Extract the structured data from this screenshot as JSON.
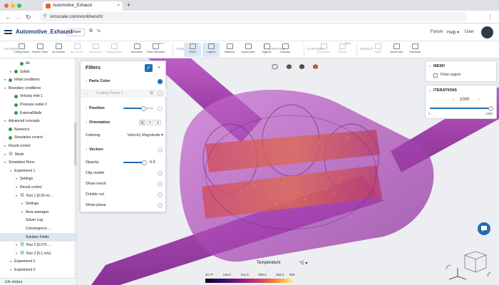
{
  "browser": {
    "tab_title": "Automotive_Exhaust",
    "tab_close": "×",
    "new_tab": "+",
    "url": "simscale.com/workbench/",
    "back": "←",
    "forward": "→",
    "reload": "↻",
    "menu": "⋮"
  },
  "header": {
    "project": "Automotive_Exhaust",
    "share": "Share",
    "links": [
      "Forum",
      "Help ▾",
      "User"
    ],
    "avatar_initial": ""
  },
  "toolbar": {
    "groups": [
      "FILTERS",
      "VIEW",
      "COMPARE",
      "CAPTURE",
      "RESULT"
    ],
    "tools": [
      {
        "label": "Cutting Plane",
        "dim": false,
        "active": false
      },
      {
        "label": "Particle Trace",
        "dim": false,
        "active": false
      },
      {
        "label": "Iso Surface",
        "dim": false,
        "active": false
      },
      {
        "label": "Iso Volume",
        "dim": true,
        "active": false
      },
      {
        "label": "Streamlines",
        "dim": true,
        "active": false
      },
      {
        "label": "Displacement",
        "dim": true,
        "active": false
      },
      {
        "label": "Animation",
        "dim": false,
        "active": false
      },
      {
        "label": "Field Calculator",
        "dim": false,
        "active": false,
        "beta": "BETA"
      },
      {
        "label": "Filters",
        "dim": false,
        "active": true
      },
      {
        "label": "Legend",
        "dim": false,
        "active": true
      },
      {
        "label": "Statistics",
        "dim": false,
        "active": false
      },
      {
        "label": "Import point",
        "dim": false,
        "active": false
      },
      {
        "label": "Regions",
        "dim": false,
        "active": false
      },
      {
        "label": "Compare",
        "dim": false,
        "active": false
      },
      {
        "label": "Screenshot",
        "dim": true,
        "active": false
      },
      {
        "label": "Record",
        "dim": true,
        "active": false,
        "beta": "BETA"
      },
      {
        "label": "Reset",
        "dim": true,
        "active": false
      },
      {
        "label": "Import view",
        "dim": false,
        "active": false
      },
      {
        "label": "Download",
        "dim": false,
        "active": false
      }
    ]
  },
  "tree": {
    "items": [
      {
        "label": "Air",
        "indent": 3,
        "arrow": false,
        "status": "ok"
      },
      {
        "label": "Solids",
        "indent": 2,
        "arrow": true,
        "status": "ok"
      },
      {
        "label": "Initial conditions",
        "indent": 1,
        "arrow": true,
        "status": "ok"
      },
      {
        "label": "Boundary conditions",
        "indent": 1,
        "arrow": true,
        "status": "none"
      },
      {
        "label": "Velocity inlet 1",
        "indent": 2,
        "arrow": false,
        "status": "ok"
      },
      {
        "label": "Pressure outlet 2",
        "indent": 2,
        "arrow": false,
        "status": "ok"
      },
      {
        "label": "ExternalWalls",
        "indent": 2,
        "arrow": false,
        "status": "ok"
      },
      {
        "label": "Advanced concepts",
        "indent": 1,
        "arrow": true,
        "status": "none"
      },
      {
        "label": "Numerics",
        "indent": 1,
        "arrow": false,
        "status": "ok"
      },
      {
        "label": "Simulation control",
        "indent": 1,
        "arrow": false,
        "status": "ok"
      },
      {
        "label": "Result control",
        "indent": 1,
        "arrow": true,
        "status": "none"
      },
      {
        "label": "Mesh",
        "indent": 1,
        "arrow": true,
        "status": "gear"
      },
      {
        "label": "Simulation Runs",
        "indent": 1,
        "arrow": true,
        "status": "none"
      },
      {
        "label": "Experiment 1",
        "indent": 2,
        "arrow": true,
        "status": "none"
      },
      {
        "label": "Settings",
        "indent": 3,
        "arrow": true,
        "status": "none"
      },
      {
        "label": "Result control",
        "indent": 3,
        "arrow": true,
        "status": "none"
      },
      {
        "label": "Run 1 [0.05 m/...",
        "indent": 3,
        "arrow": true,
        "status": "gear"
      },
      {
        "label": "Settings",
        "indent": 4,
        "arrow": true,
        "status": "none"
      },
      {
        "label": "Area averages",
        "indent": 4,
        "arrow": true,
        "status": "none"
      },
      {
        "label": "Solver Log",
        "indent": 4,
        "arrow": false,
        "status": "none"
      },
      {
        "label": "Convergence ...",
        "indent": 4,
        "arrow": false,
        "status": "none"
      },
      {
        "label": "Solution Fields",
        "indent": 4,
        "arrow": false,
        "status": "none",
        "selected": true
      },
      {
        "label": "Run 2 [0.075 ...",
        "indent": 3,
        "arrow": true,
        "status": "gear"
      },
      {
        "label": "Run 3 [0.1 m/s]",
        "indent": 3,
        "arrow": true,
        "status": "gear"
      },
      {
        "label": "Experiment 2",
        "indent": 2,
        "arrow": true,
        "status": "none"
      },
      {
        "label": "Experiment 3",
        "indent": 2,
        "arrow": true,
        "status": "none"
      }
    ],
    "job_status": "Job status"
  },
  "filters": {
    "title": "Filters",
    "parts_color": "Parts Color",
    "cutting_plane": "Cutting Plane 1",
    "position": "Position",
    "orientation": "Orientation",
    "axes": [
      "X",
      "Y",
      "Z"
    ],
    "coloring_label": "Coloring",
    "coloring_value": "Velocity Magnitude ▾",
    "vectors": "Vectors",
    "opacity_label": "Opacity",
    "opacity_value": "0.9",
    "options": [
      "Clip model",
      "Show mesh",
      "Crinkle cut",
      "Show plane"
    ]
  },
  "mesh_panel": {
    "title": "MESH",
    "item": "Flow region"
  },
  "iterations_panel": {
    "title": "ITERATIONS",
    "value": "1000",
    "min": "0",
    "max": "1000"
  },
  "legend": {
    "label": "Temperature",
    "unit": "°C ▾",
    "ticks": [
      "20.77",
      "116.6",
      "212.5",
      "308.3",
      "404.2",
      "500"
    ]
  },
  "colors": {
    "accent": "#1f6fb2",
    "ok": "#2e9b45",
    "pipe": "#a23aa8",
    "hot": "#e0503a"
  }
}
